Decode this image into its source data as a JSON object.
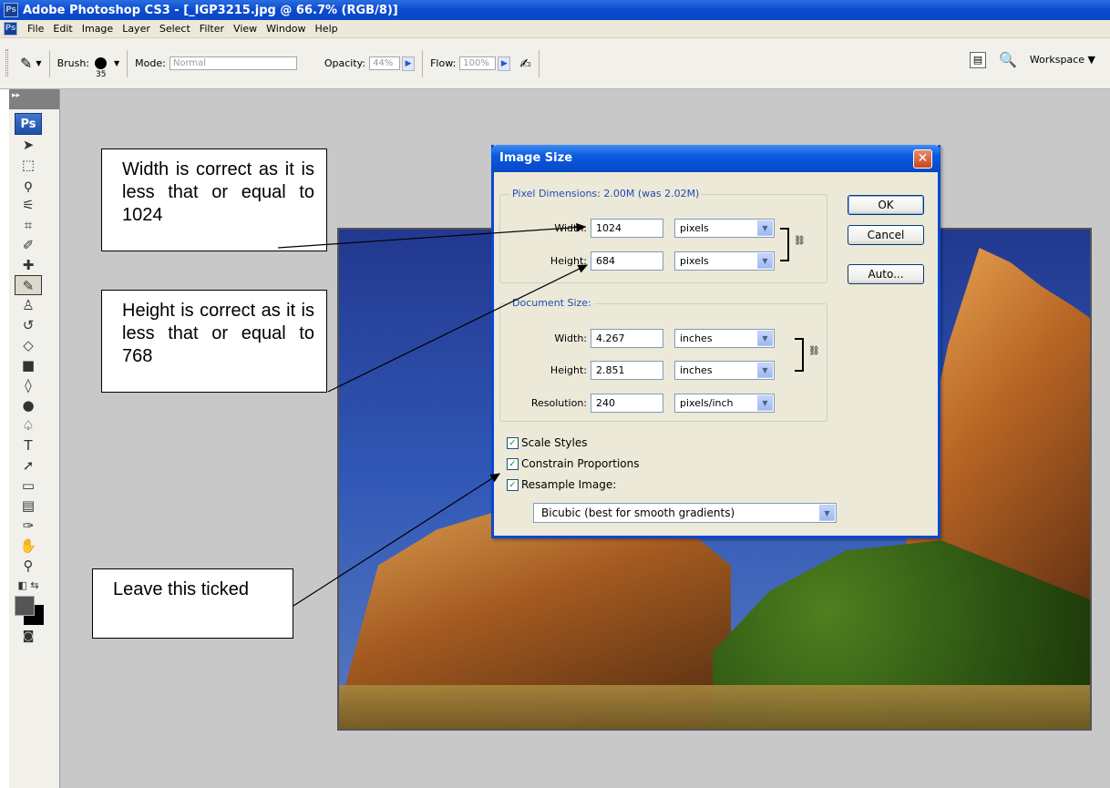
{
  "window": {
    "app_icon": "Ps",
    "title": "Adobe Photoshop CS3 - [_IGP3215.jpg @ 66.7% (RGB/8)]"
  },
  "menubar": {
    "items": [
      "File",
      "Edit",
      "Image",
      "Layer",
      "Select",
      "Filter",
      "View",
      "Window",
      "Help"
    ]
  },
  "options": {
    "brush_label": "Brush:",
    "brush_size": "35",
    "mode_label": "Mode:",
    "mode_value": "Normal",
    "opacity_label": "Opacity:",
    "opacity_value": "44%",
    "flow_label": "Flow:",
    "flow_value": "100%",
    "workspace_label": "Workspace"
  },
  "tools": {
    "logo": "Ps",
    "icons": [
      "move-icon",
      "marquee-icon",
      "lasso-icon",
      "magic-wand-icon",
      "crop-icon",
      "slice-icon",
      "healing-icon",
      "brush-icon",
      "clone-stamp-icon",
      "history-brush-icon",
      "eraser-icon",
      "gradient-icon",
      "blur-icon",
      "dodge-icon",
      "pen-icon",
      "type-icon",
      "path-select-icon",
      "shape-icon",
      "notes-icon",
      "eyedropper-icon",
      "hand-icon",
      "zoom-icon"
    ]
  },
  "dialog": {
    "title": "Image Size",
    "pixel_dimensions": {
      "label": "Pixel Dimensions:  2.00M (was 2.02M)",
      "width_label": "Width:",
      "width_value": "1024",
      "width_unit": "pixels",
      "height_label": "Height:",
      "height_value": "684",
      "height_unit": "pixels"
    },
    "document_size": {
      "label": "Document Size:",
      "width_label": "Width:",
      "width_value": "4.267",
      "width_unit": "inches",
      "height_label": "Height:",
      "height_value": "2.851",
      "height_unit": "inches",
      "resolution_label": "Resolution:",
      "resolution_value": "240",
      "resolution_unit": "pixels/inch"
    },
    "buttons": {
      "ok": "OK",
      "cancel": "Cancel",
      "auto": "Auto..."
    },
    "checkboxes": {
      "scale_styles": "Scale Styles",
      "constrain": "Constrain Proportions",
      "resample": "Resample Image:"
    },
    "resample_method": "Bicubic (best for smooth gradients)"
  },
  "annotations": {
    "width_note": "Width is correct as it is less that or equal to 1024",
    "height_note": "Height is correct as it is less that or equal to 768",
    "tick_note": "Leave this ticked"
  }
}
